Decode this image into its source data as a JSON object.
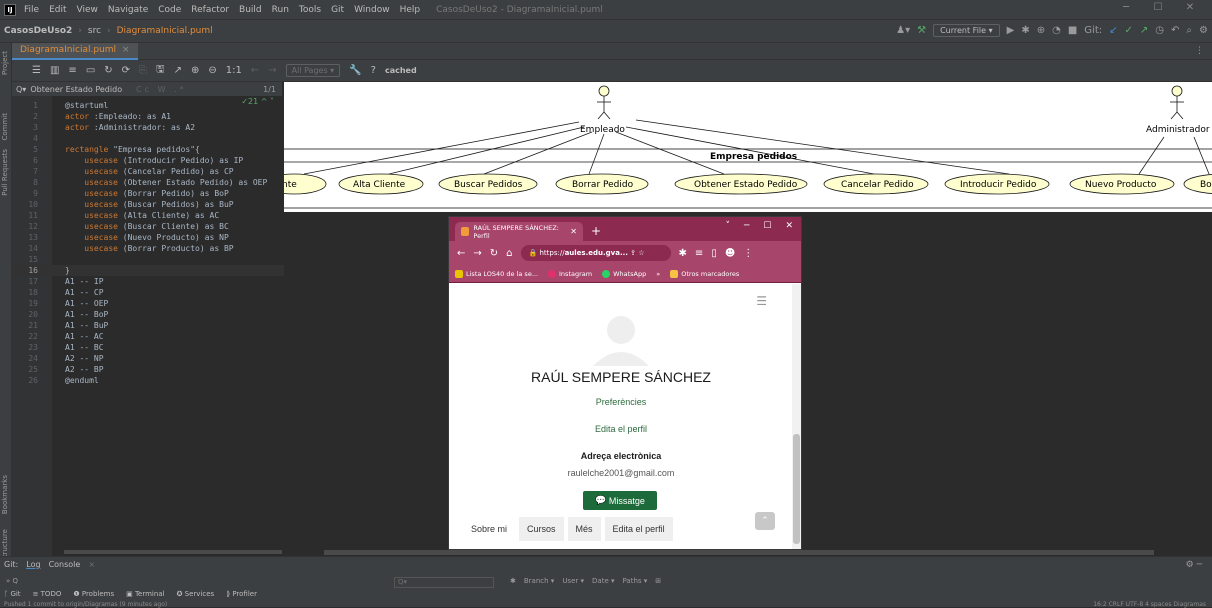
{
  "menubar": {
    "logo": "IJ",
    "items": [
      "File",
      "Edit",
      "View",
      "Navigate",
      "Code",
      "Refactor",
      "Build",
      "Run",
      "Tools",
      "Git",
      "Window",
      "Help"
    ],
    "window_title": "CasosDeUso2 - DiagramaInicial.puml"
  },
  "navbar": {
    "project": "CasosDeUso2",
    "folder": "src",
    "file": "DiagramaInicial.puml",
    "run_config": "Current File",
    "git_label": "Git:"
  },
  "editor_tab": {
    "label": "DiagramaInicial.puml"
  },
  "plantuml_toolbar": {
    "pages": "All Pages",
    "cached": "cached",
    "help": "?"
  },
  "find": {
    "query": "Obtener Estado Pedido",
    "options": "Cc W .*",
    "count": "1/1"
  },
  "inspection": "21",
  "code_lines": [
    {
      "n": "1",
      "t": "@startuml"
    },
    {
      "n": "2",
      "t": "actor :Empleado: as A1"
    },
    {
      "n": "3",
      "t": "actor :Administrador: as A2"
    },
    {
      "n": "4",
      "t": ""
    },
    {
      "n": "5",
      "t": "rectangle \"Empresa pedidos\"{"
    },
    {
      "n": "6",
      "t": "    usecase (Introducir Pedido) as IP"
    },
    {
      "n": "7",
      "t": "    usecase (Cancelar Pedido) as CP"
    },
    {
      "n": "8",
      "t": "    usecase (Obtener Estado Pedido) as OEP"
    },
    {
      "n": "9",
      "t": "    usecase (Borrar Pedido) as BoP"
    },
    {
      "n": "10",
      "t": "    usecase (Buscar Pedidos) as BuP"
    },
    {
      "n": "11",
      "t": "    usecase (Alta Cliente) as AC"
    },
    {
      "n": "12",
      "t": "    usecase (Buscar Cliente) as BC"
    },
    {
      "n": "13",
      "t": "    usecase (Nuevo Producto) as NP"
    },
    {
      "n": "14",
      "t": "    usecase (Borrar Producto) as BP"
    },
    {
      "n": "15",
      "t": ""
    },
    {
      "n": "16",
      "t": "}"
    },
    {
      "n": "17",
      "t": "A1 -- IP"
    },
    {
      "n": "18",
      "t": "A1 -- CP"
    },
    {
      "n": "19",
      "t": "A1 -- OEP"
    },
    {
      "n": "20",
      "t": "A1 -- BoP"
    },
    {
      "n": "21",
      "t": "A1 -- BuP"
    },
    {
      "n": "22",
      "t": "A1 -- AC"
    },
    {
      "n": "23",
      "t": "A1 -- BC"
    },
    {
      "n": "24",
      "t": "A2 -- NP"
    },
    {
      "n": "25",
      "t": "A2 -- BP"
    },
    {
      "n": "26",
      "t": "@enduml"
    }
  ],
  "diagram": {
    "actor1": "Empleado",
    "actor2": "Administrador",
    "rect_title": "Empresa pedidos",
    "usecases": [
      "nte",
      "Alta Cliente",
      "Buscar Pedidos",
      "Borrar Pedido",
      "Obtener Estado Pedido",
      "Cancelar Pedido",
      "Introducir Pedido",
      "Nuevo Producto",
      "Bo"
    ]
  },
  "browser": {
    "tab_title": "RAÚL SEMPERE SÁNCHEZ: Perfil",
    "url_prefix": "https://",
    "url_host": "aules.edu.gva...",
    "bookmarks": [
      "Lista LOS40 de la se...",
      "Instagram",
      "WhatsApp",
      "»",
      "Otros marcadores"
    ],
    "name": "RAÚL SEMPERE SÁNCHEZ",
    "link1": "Preferències",
    "link2": "Edita el perfil",
    "email_label": "Adreça electrònica",
    "email": "raulelche2001@gmail.com",
    "message_button": "Missatge",
    "tabs": [
      "Sobre mi",
      "Cursos",
      "Més",
      "Edita el perfil"
    ]
  },
  "bottom": {
    "panel_label": "Git:",
    "tab_log": "Log",
    "tab_console": "Console",
    "filters": [
      "Branch ▾",
      "User ▾",
      "Date ▾",
      "Paths ▾"
    ],
    "toolwindows": [
      "Git",
      "TODO",
      "Problems",
      "Terminal",
      "Services",
      "Profiler"
    ],
    "status_left": "Pushed 1 commit to origin/Diagramas (9 minutes ago)",
    "status_right": "16:2   CRLF   UTF-8   4 spaces   Diagramas"
  },
  "side_labels": [
    "Project",
    "Commit",
    "Pull Requests",
    "Bookmarks",
    "Structure"
  ]
}
